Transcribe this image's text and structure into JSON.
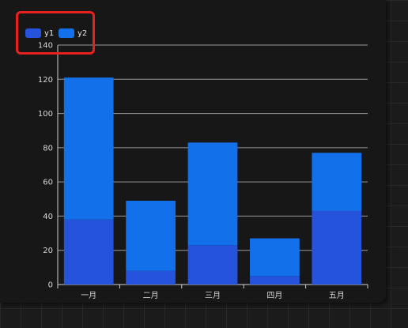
{
  "chart_data": {
    "type": "bar",
    "stacked": true,
    "categories": [
      "一月",
      "二月",
      "三月",
      "四月",
      "五月"
    ],
    "series": [
      {
        "name": "y1",
        "values": [
          38,
          8,
          23,
          5,
          43
        ],
        "color": "#2553db"
      },
      {
        "name": "y2",
        "values": [
          83,
          41,
          60,
          22,
          34
        ],
        "color": "#1270ea"
      }
    ],
    "ylim": [
      0,
      140
    ],
    "yticks": [
      0,
      20,
      40,
      60,
      80,
      100,
      120,
      140
    ],
    "grid": true,
    "legend_position": "top-left",
    "title": "",
    "xlabel": "",
    "ylabel": ""
  },
  "colors": {
    "highlight_border": "#e8201e",
    "grid_line": "#9a9a9a",
    "text": "#d6d6d6"
  }
}
